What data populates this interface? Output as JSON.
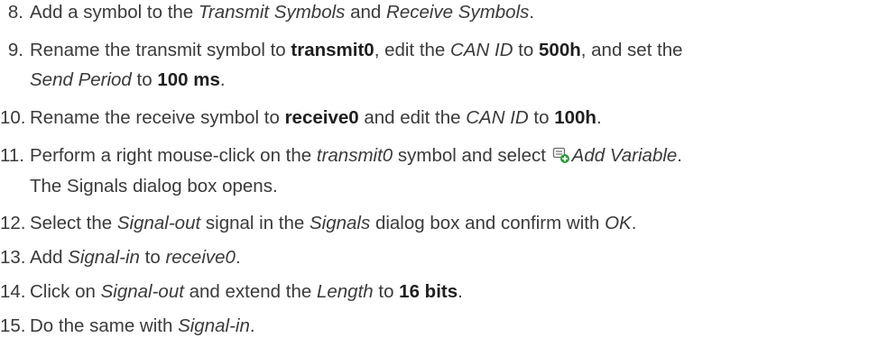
{
  "steps": [
    {
      "number": "8.",
      "parts": {
        "p1": "Add a symbol to the ",
        "p2": "Transmit Symbols",
        "p3": " and ",
        "p4": "Receive Symbols",
        "p5": "."
      }
    },
    {
      "number": "9.",
      "parts": {
        "p1": "Rename the transmit symbol to ",
        "p2": "transmit0",
        "p3": ", edit the ",
        "p4": "CAN ID",
        "p5": " to ",
        "p6": "500h",
        "p7": ", and set the"
      },
      "continuation": {
        "c1": "Send Period",
        "c2": " to ",
        "c3": "100 ms",
        "c4": "."
      }
    },
    {
      "number": "10.",
      "parts": {
        "p1": "Rename the receive symbol to ",
        "p2": "receive0",
        "p3": " and edit the ",
        "p4": "CAN ID",
        "p5": " to ",
        "p6": "100h",
        "p7": "."
      }
    },
    {
      "number": "11.",
      "parts": {
        "p1": "Perform a right mouse-click on the ",
        "p2": "transmit0",
        "p3": " symbol and select ",
        "icon": "add-variable-icon",
        "p4": "Add Variable",
        "p5": "."
      },
      "continuation": {
        "c1": "The Signals dialog box opens."
      }
    },
    {
      "number": "12.",
      "parts": {
        "p1": "Select the ",
        "p2": "Signal-out",
        "p3": " signal in the ",
        "p4": "Signals",
        "p5": " dialog box and confirm with ",
        "p6": "OK",
        "p7": "."
      }
    },
    {
      "number": "13.",
      "parts": {
        "p1": "Add ",
        "p2": "Signal-in",
        "p3": " to ",
        "p4": "receive0",
        "p5": "."
      }
    },
    {
      "number": "14.",
      "parts": {
        "p1": "Click on ",
        "p2": "Signal-out",
        "p3": " and extend the ",
        "p4": "Length",
        "p5": " to ",
        "p6": "16 bits",
        "p7": "."
      }
    },
    {
      "number": "15.",
      "parts": {
        "p1": "Do the same with ",
        "p2": "Signal-in",
        "p3": "."
      }
    }
  ],
  "colors": {
    "text": "#3a3a3a",
    "bold": "#1f1f1f",
    "icon_green": "#2e9e3e"
  }
}
